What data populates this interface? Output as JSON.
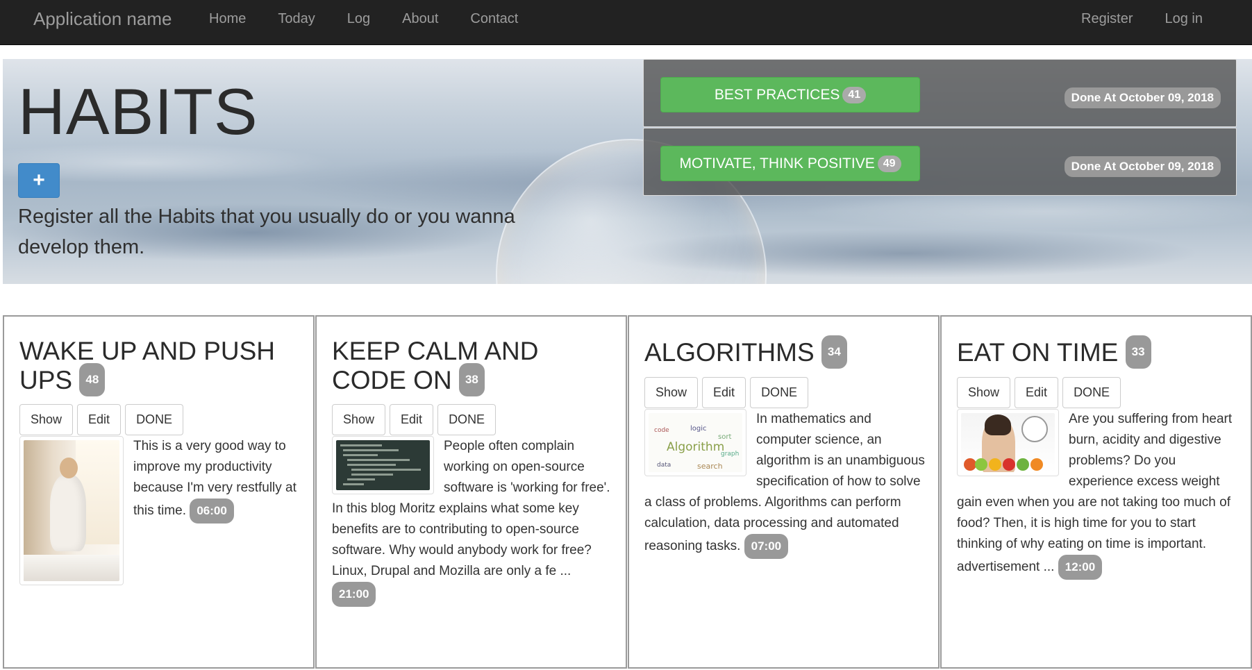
{
  "navbar": {
    "brand": "Application name",
    "links": [
      "Home",
      "Today",
      "Log",
      "About",
      "Contact"
    ],
    "right_links": [
      "Register",
      "Log in"
    ]
  },
  "hero": {
    "title": "HABITS",
    "add_button_icon": "plus-icon",
    "add_button_label": "+",
    "description": "Register all the Habits that you usually do or you wanna develop them."
  },
  "best_practices": [
    {
      "label": "BEST PRACTICES",
      "count": "41",
      "done_at": "Done At October 09, 2018"
    },
    {
      "label": "MOTIVATE, THINK POSITIVE",
      "count": "49",
      "done_at": "Done At October 09, 2018"
    }
  ],
  "buttons": {
    "show": "Show",
    "edit": "Edit",
    "done": "DONE"
  },
  "habits": [
    {
      "title": "WAKE UP AND PUSH UPS",
      "count": "48",
      "text": "This is a very good way to improve my productivity because I'm very restfully at this time.",
      "time": "06:00"
    },
    {
      "title": "KEEP CALM AND CODE ON",
      "count": "38",
      "text": "People often complain working on open-source software is 'working for free'. In this blog Moritz explains what some key benefits are to contributing to open-source software. Why would anybody work for free? Linux, Drupal and Mozilla are only a fe ...",
      "time": "21:00"
    },
    {
      "title": "ALGORITHMS",
      "count": "34",
      "text": "In mathematics and computer science, an algorithm is an unambiguous specification of how to solve a class of problems. Algorithms can perform calculation, data processing and automated reasoning tasks.",
      "time": "07:00"
    },
    {
      "title": "EAT ON TIME",
      "count": "33",
      "text": "Are you suffering from heart burn, acidity and digestive problems? Do you experience excess weight gain even when you are not taking too much of food? Then, it is high time for you to start thinking of why eating on time is important. advertisement ...",
      "time": "12:00"
    }
  ],
  "colors": {
    "navbar_bg": "#222222",
    "primary": "#428bca",
    "success": "#5cb85c",
    "badge": "#999999"
  }
}
